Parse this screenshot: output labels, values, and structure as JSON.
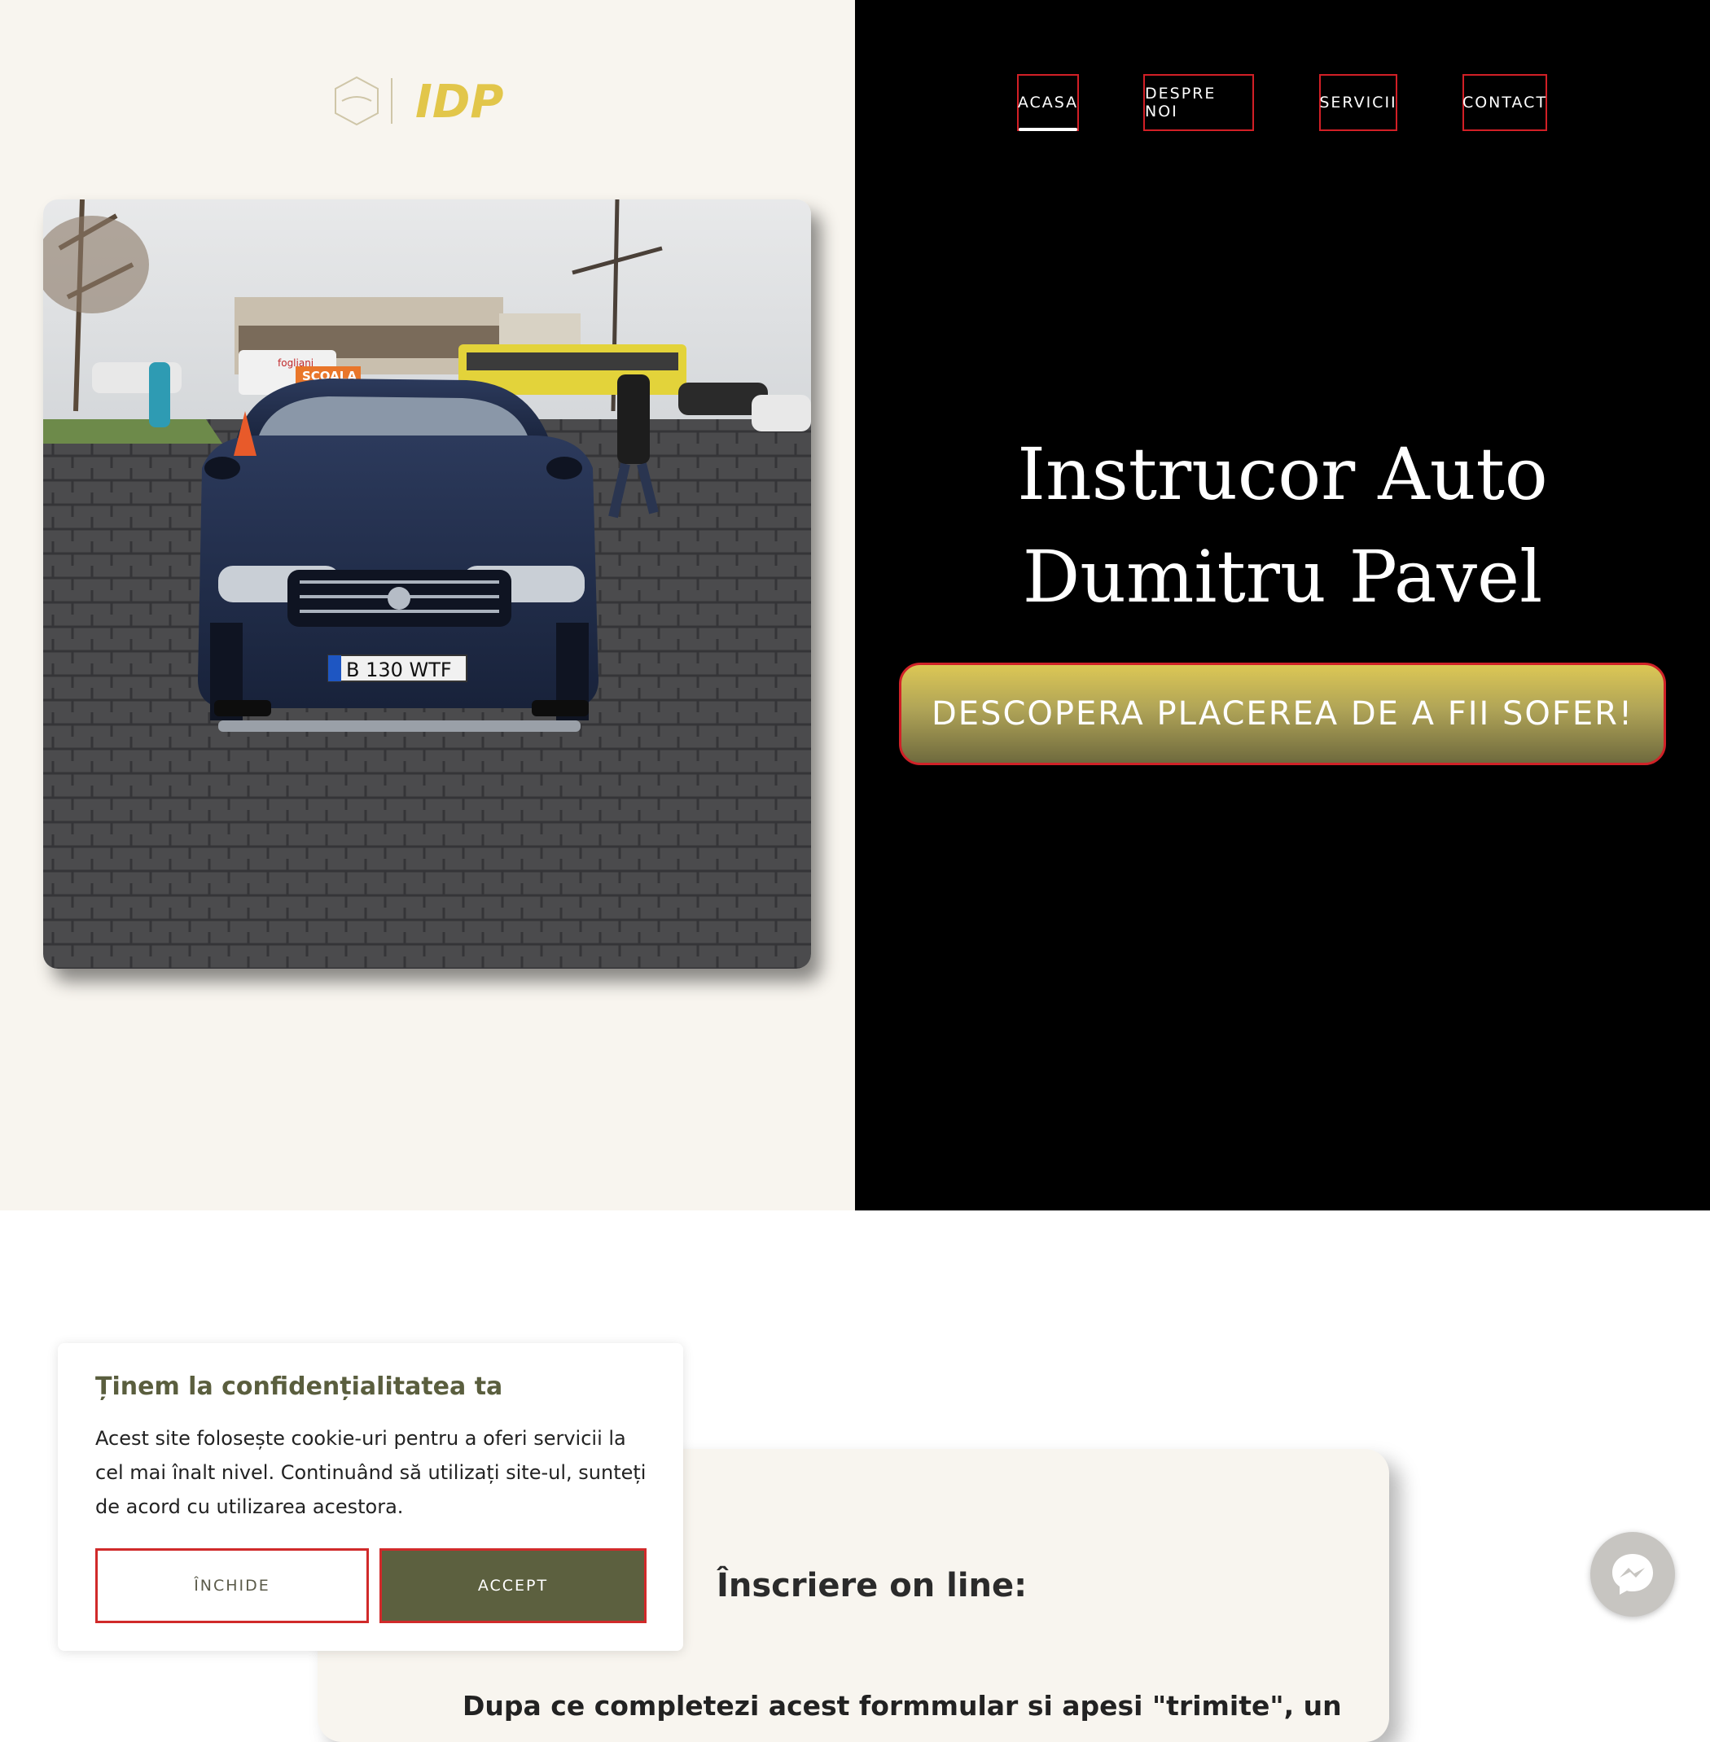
{
  "brand": {
    "logo_text": "IDP",
    "accent": "#e2c64a",
    "dark_accent": "#5c603f",
    "border_red": "#d21f26"
  },
  "nav": {
    "items": [
      {
        "label": "ACASA",
        "active": true
      },
      {
        "label": "DESPRE NOI"
      },
      {
        "label": "SERVICII"
      },
      {
        "label": "CONTACT"
      }
    ]
  },
  "hero": {
    "title_line1": "Instrucor Auto",
    "title_line2": "Dumitru Pavel",
    "cta_label": "DESCOPERA PLACEREA DE A FII SOFER!",
    "photo": {
      "roof_sign": "SCOALA",
      "plate": "B 130 WTF",
      "plate_country": "RO",
      "shop_sign": "fogliani"
    }
  },
  "signup": {
    "title": "Înscriere on line:",
    "text": "Dupa ce completezi acest formmular si apesi \"trimite\", un"
  },
  "cookie": {
    "title": "Ținem la confidențialitatea ta",
    "text": "Acest site folosește cookie-uri pentru a oferi servicii la cel mai înalt nivel. Continuând să utilizați site-ul, sunteți de acord cu utilizarea acestora.",
    "close_label": "ÎNCHIDE",
    "accept_label": "ACCEPT"
  },
  "icons": {
    "messenger": "messenger-icon"
  }
}
